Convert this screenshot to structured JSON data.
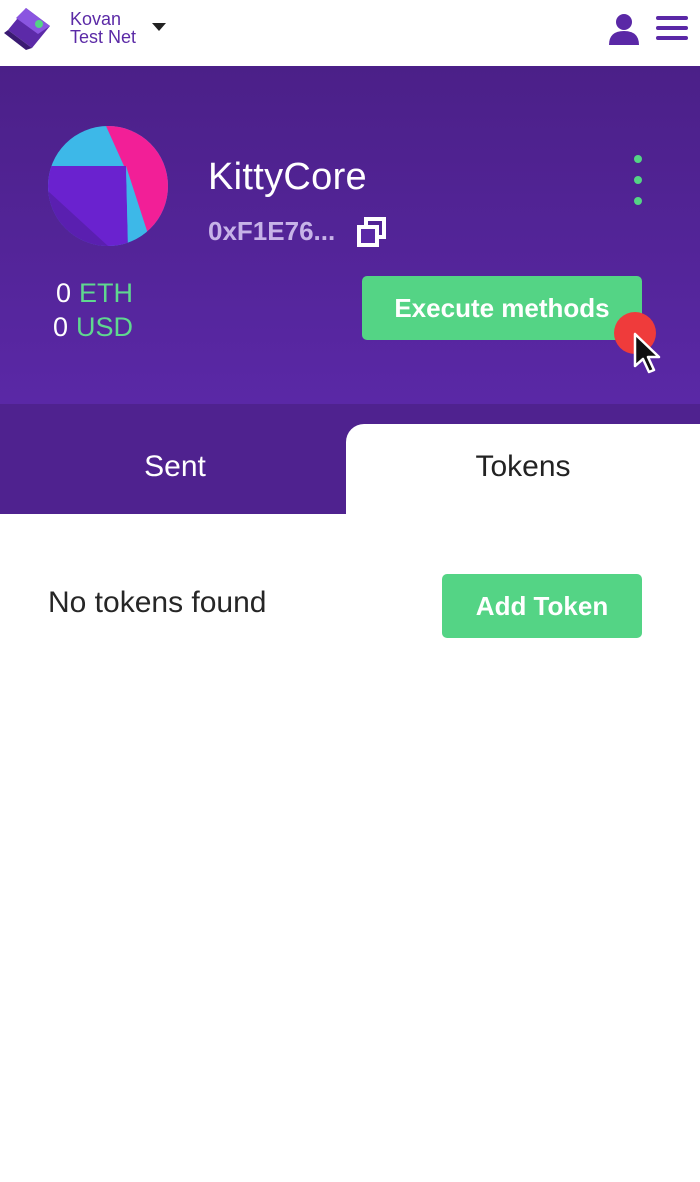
{
  "header": {
    "network_line1": "Kovan",
    "network_line2": "Test Net",
    "icons": [
      "wallet-logo-icon",
      "caret-down-icon",
      "user-icon",
      "hamburger-menu-icon"
    ]
  },
  "account": {
    "name": "KittyCore",
    "address": "0xF1E76...",
    "balances": [
      {
        "amount": "0",
        "unit": "ETH"
      },
      {
        "amount": "0",
        "unit": "USD"
      }
    ],
    "execute_label": "Execute methods",
    "icons": [
      "identicon",
      "copy-icon",
      "more-vertical-icon",
      "cursor-icon"
    ]
  },
  "tabs": [
    {
      "label": "Sent",
      "active": false
    },
    {
      "label": "Tokens",
      "active": true
    }
  ],
  "tokens": {
    "empty_message": "No tokens found",
    "add_label": "Add Token"
  },
  "colors": {
    "brand_purple": "#5a28a6",
    "accent_green": "#54d485",
    "click_indicator": "#ef3b3b"
  }
}
